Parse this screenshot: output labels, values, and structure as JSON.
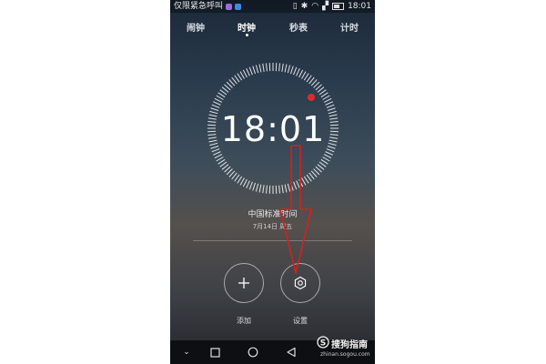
{
  "status_bar": {
    "carrier_text": "仅限紧急呼叫",
    "time": "18:01"
  },
  "tabs": [
    {
      "label": "闹钟",
      "active": false
    },
    {
      "label": "时钟",
      "active": true
    },
    {
      "label": "秒表",
      "active": false
    },
    {
      "label": "计时",
      "active": false
    }
  ],
  "clock": {
    "time": "18:01",
    "timezone": "中国标准时间",
    "date": "7月14日 周五"
  },
  "actions": {
    "add_label": "添加",
    "settings_label": "设置"
  },
  "watermark": {
    "text": "搜狗指南",
    "url": "zhinan.sogou.com"
  },
  "colors": {
    "accent_dot": "#e02a2a",
    "annotation_arrow": "#d81e1e"
  }
}
